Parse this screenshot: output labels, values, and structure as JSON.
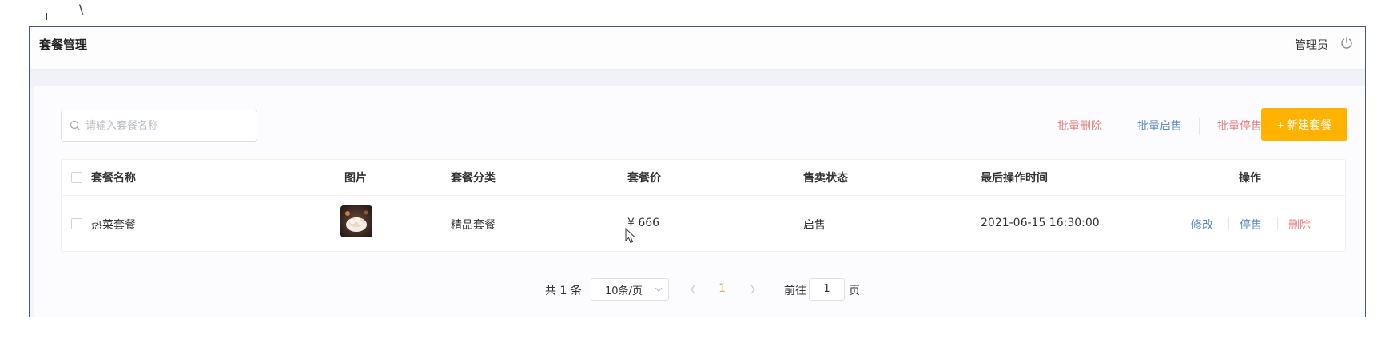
{
  "header": {
    "title": "套餐管理",
    "user": "管理员",
    "power_icon": "power-icon"
  },
  "search": {
    "placeholder": "请输入套餐名称",
    "value": ""
  },
  "toolbar": {
    "batch_delete": "批量删除",
    "batch_enable": "批量启售",
    "batch_disable": "批量停售",
    "new_label": "+ 新建套餐"
  },
  "table": {
    "columns": [
      "套餐名称",
      "图片",
      "套餐分类",
      "套餐价",
      "售卖状态",
      "最后操作时间",
      "操作"
    ],
    "rows": [
      {
        "name": "热菜套餐",
        "category": "精品套餐",
        "price": "¥ 666",
        "status": "启售",
        "updated": "2021-06-15 16:30:00",
        "actions": [
          "修改",
          "停售",
          "删除"
        ]
      }
    ]
  },
  "pagination": {
    "total": "共 1 条",
    "page_size": "10条/页",
    "current_page": "1",
    "goto_label": "前往",
    "goto_value": "1",
    "page_suffix": "页"
  },
  "colors": {
    "accent": "#ffb300",
    "danger": "#e0837e",
    "link": "#5b8ec0",
    "frame_border": "#4a5a76"
  }
}
